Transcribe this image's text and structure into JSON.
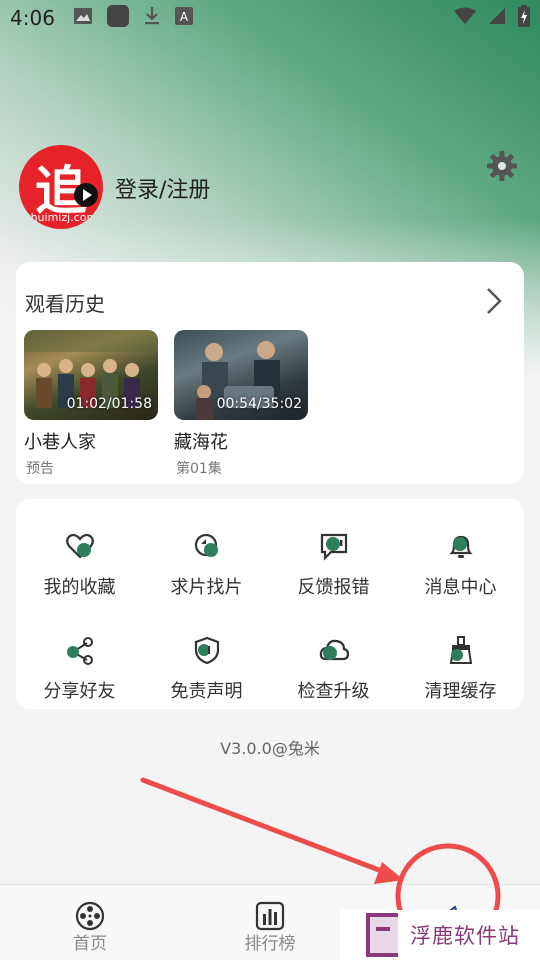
{
  "status_bar": {
    "time": "4:06",
    "icons_left": [
      "image-icon",
      "app-icon",
      "download-icon",
      "font-icon"
    ],
    "icons_right": [
      "wifi-icon",
      "signal-icon",
      "battery-icon"
    ]
  },
  "profile": {
    "avatar_char": "追",
    "avatar_url": "zhuimizj.com",
    "login_label": "登录/注册"
  },
  "history": {
    "title": "观看历史",
    "items": [
      {
        "title": "小巷人家",
        "subtitle": "预告",
        "progress": "01:02/01:58"
      },
      {
        "title": "藏海花",
        "subtitle": "第01集",
        "progress": "00:54/35:02"
      }
    ]
  },
  "menu": {
    "items": [
      {
        "label": "我的收藏",
        "icon": "heart-icon"
      },
      {
        "label": "求片找片",
        "icon": "search-film-icon"
      },
      {
        "label": "反馈报错",
        "icon": "feedback-icon"
      },
      {
        "label": "消息中心",
        "icon": "bell-icon"
      },
      {
        "label": "分享好友",
        "icon": "share-icon"
      },
      {
        "label": "免责声明",
        "icon": "shield-icon"
      },
      {
        "label": "检查升级",
        "icon": "cloud-upgrade-icon"
      },
      {
        "label": "清理缓存",
        "icon": "broom-icon"
      }
    ]
  },
  "version": "V3.0.0@兔米",
  "bottom_nav": {
    "items": [
      {
        "label": "首页",
        "icon": "film-reel-icon"
      },
      {
        "label": "排行榜",
        "icon": "ranking-chart-icon"
      },
      {
        "label": "",
        "icon": "profile-leaf-icon"
      }
    ]
  },
  "watermark": {
    "text": "浮鹿软件站"
  },
  "colors": {
    "accent": "#2e7d5b",
    "annotation": "#ee4b4b",
    "watermark": "#8a3a7a"
  }
}
